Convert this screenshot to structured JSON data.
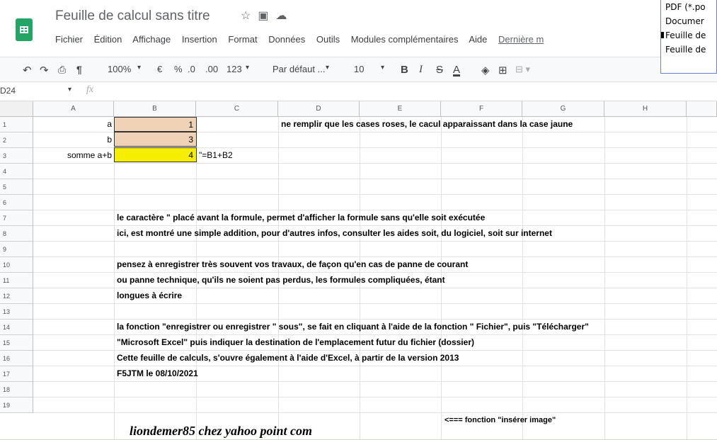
{
  "header": {
    "doc_title": "Feuille de calcul sans titre",
    "title_icons": [
      "star-icon",
      "folder-icon",
      "cloud-icon"
    ],
    "menu": [
      "Fichier",
      "Édition",
      "Affichage",
      "Insertion",
      "Format",
      "Données",
      "Outils",
      "Modules complémentaires",
      "Aide"
    ],
    "last_edit": "Dernière m"
  },
  "popup": {
    "items": [
      "PDF (*.po",
      "Documer",
      "Feuille de",
      "Feuille de"
    ]
  },
  "toolbar": {
    "zoom": "100%",
    "currency": "€",
    "percent": "%",
    "dec_less": ".0",
    "dec_more": ".00",
    "format_123": "123",
    "font": "Par défaut ...",
    "font_size": "10",
    "bold": "B",
    "italic": "I",
    "strike": "S",
    "text_color": "A"
  },
  "formula_bar": {
    "cell_ref": "D24",
    "fx": "fx",
    "value": ""
  },
  "columns": [
    "A",
    "B",
    "C",
    "D",
    "E",
    "F",
    "G",
    "H"
  ],
  "rows": [
    "1",
    "2",
    "3",
    "4",
    "5",
    "6",
    "7",
    "8",
    "9",
    "10",
    "11",
    "12",
    "13",
    "14",
    "15",
    "16",
    "17",
    "18",
    "19"
  ],
  "cells": {
    "a1": "a",
    "b1": "1",
    "d1": "ne remplir que les cases roses, le cacul apparaissant dans la case jaune",
    "a2": "b",
    "b2": "3",
    "a3": "somme a+b",
    "b3": "4",
    "c3": "\"=B1+B2",
    "b6": "le caractère \" placé avant la formule, permet d'afficher la formule sans qu'elle soit exécutée",
    "b7": "ici, est montré une simple addition, pour d'autres infos, consulter les aides soit, du logiciel, soit sur internet",
    "b9": "pensez à enregistrer très souvent vos travaux, de façon qu'en cas de panne de courant",
    "b10": "ou panne technique, qu'ils ne soient pas perdus, les formules compliquées, étant",
    "b11": "longues à écrire",
    "b13": "la fonction \"enregistrer ou enregistrer \" sous\", se fait en cliquant à l'aide de la fonction \" Fichier\", puis \"Télécharger\"",
    "b14": "\"Microsoft Excel\" puis indiquer la destination de l'emplacement futur du fichier (dossier)",
    "b15": "Cette feuille de calculs, s'ouvre également à l'aide d'Excel, à partir de la version 2013",
    "b16": "F5JTM le 08/10/2021",
    "b18": "liondemer85 chez yahoo point com",
    "e18": "<=== fonction \"insérer image\""
  },
  "colors": {
    "pink_input": "#f0d3b6",
    "yellow_result": "#f5ee00",
    "sheets_green": "#22a565"
  }
}
